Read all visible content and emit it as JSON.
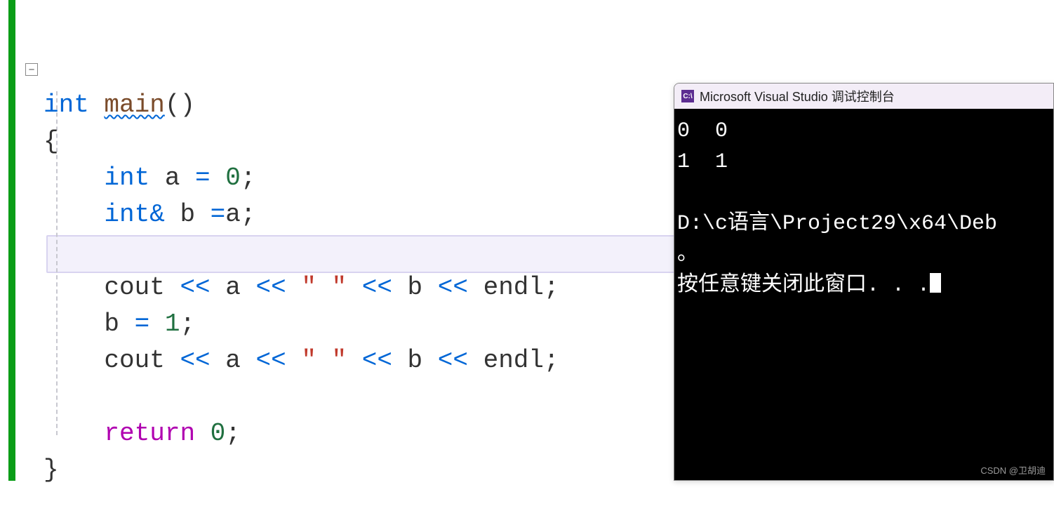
{
  "code": {
    "l1_int": "int",
    "l1_main": "main",
    "l1_parens": "()",
    "l2_brace_open": "{",
    "l3_indent": "    ",
    "l3_int": "int",
    "l3_rest": " a ",
    "l3_eq": "=",
    "l3_sp": " ",
    "l3_zero": "0",
    "l3_semi": ";",
    "l4_indent": "    ",
    "l4_int": "int",
    "l4_amp": "&",
    "l4_rest": " b ",
    "l4_eq": "=",
    "l4_a": "a",
    "l4_semi": ";",
    "l6_indent": "    ",
    "l6_cout": "cout ",
    "l6_op1": "<<",
    "l6_a": " a ",
    "l6_op2": "<<",
    "l6_sp1": " ",
    "l6_str": "\" \"",
    "l6_sp2": " ",
    "l6_op3": "<<",
    "l6_b": " b ",
    "l6_op4": "<<",
    "l6_endl": " endl",
    "l6_semi": ";",
    "l7_indent": "    ",
    "l7_b": "b ",
    "l7_eq": "=",
    "l7_sp": " ",
    "l7_one": "1",
    "l7_semi": ";",
    "l8_indent": "    ",
    "l8_cout": "cout ",
    "l8_op1": "<<",
    "l8_a": " a ",
    "l8_op2": "<<",
    "l8_sp1": " ",
    "l8_str": "\" \"",
    "l8_sp2": " ",
    "l8_op3": "<<",
    "l8_b": " b ",
    "l8_op4": "<<",
    "l8_endl": " endl",
    "l8_semi": ";",
    "l10_indent": "    ",
    "l10_return": "return",
    "l10_sp": " ",
    "l10_zero": "0",
    "l10_semi": ";",
    "l11_brace_close": "}"
  },
  "fold": {
    "symbol": "−"
  },
  "console": {
    "icon_text": "C:\\",
    "title": "Microsoft Visual Studio 调试控制台",
    "line1": "0  0",
    "line2": "1  1",
    "blank": "",
    "line3": "D:\\c语言\\Project29\\x64\\Deb",
    "line4": "。",
    "line5": "按任意键关闭此窗口. . ."
  },
  "watermark": "CSDN @卫胡迪"
}
